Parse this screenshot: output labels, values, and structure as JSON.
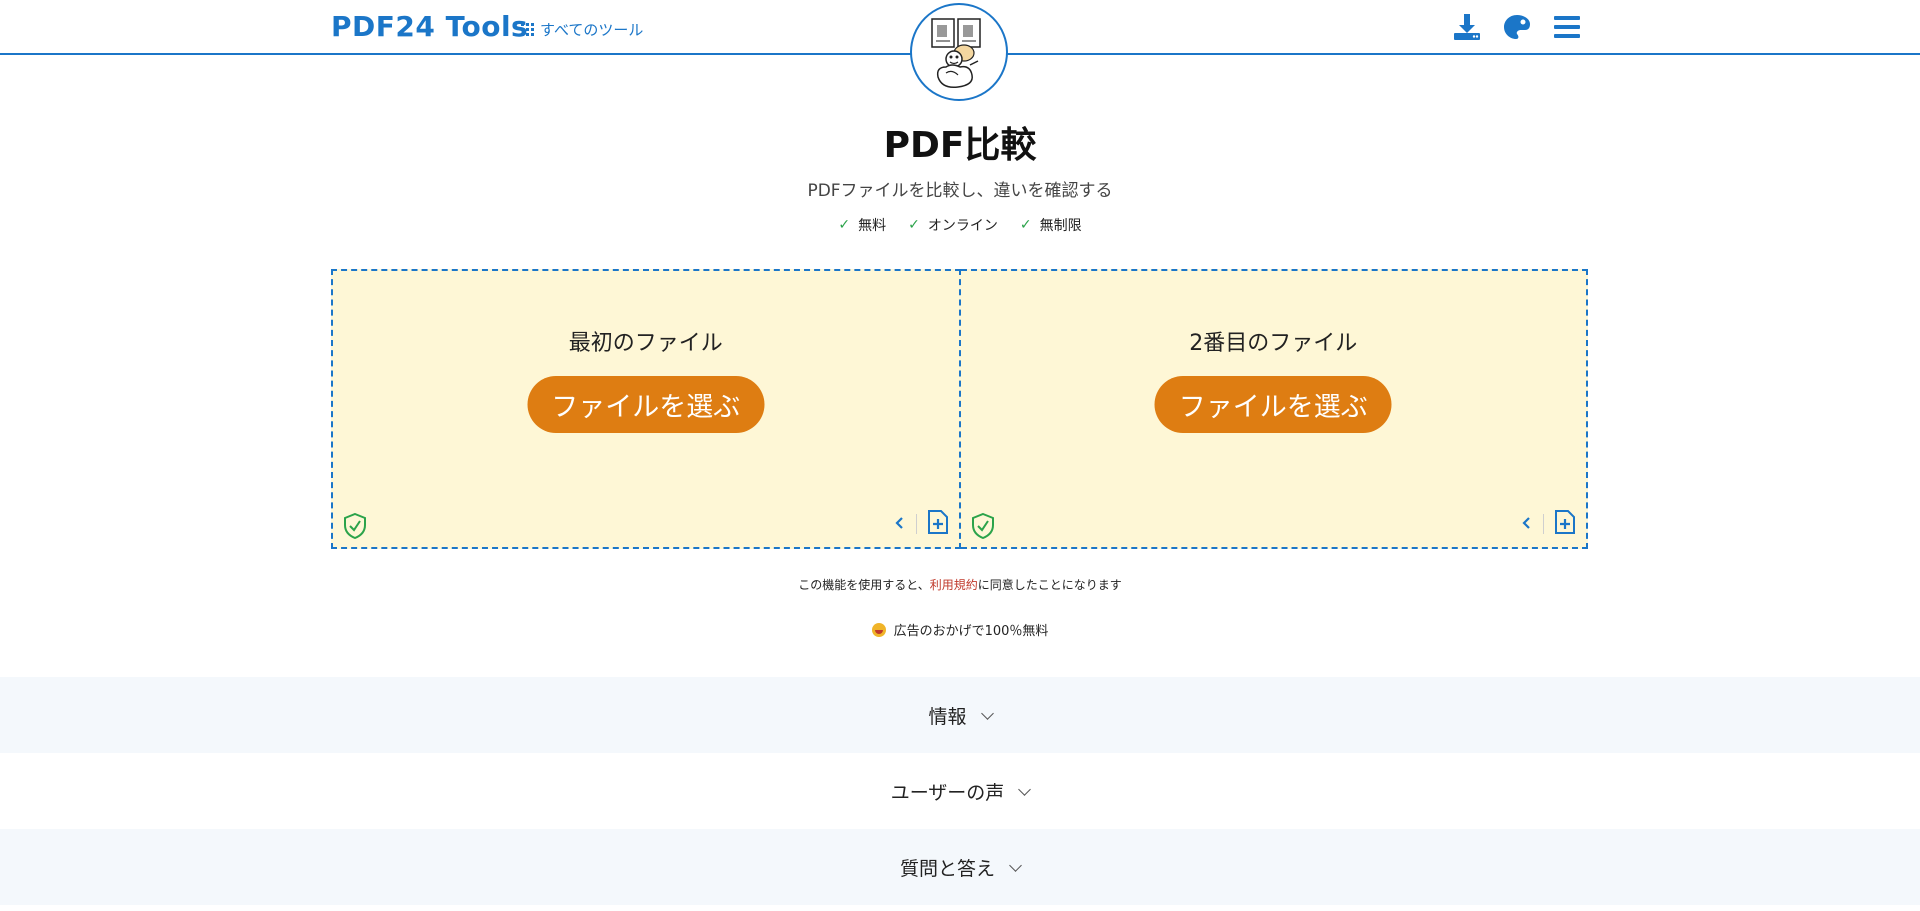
{
  "header": {
    "brand": "PDF24 Tools",
    "all_tools_label": "すべてのツール",
    "icons": [
      "download-icon",
      "palette-icon",
      "menu-icon"
    ]
  },
  "page": {
    "title": "PDF比較",
    "subtitle": "PDFファイルを比較し、違いを確認する",
    "features": [
      "無料",
      "オンライン",
      "無制限"
    ]
  },
  "dropzones": [
    {
      "label": "最初のファイル",
      "button": "ファイルを選ぶ"
    },
    {
      "label": "2番目のファイル",
      "button": "ファイルを選ぶ"
    }
  ],
  "terms": {
    "prefix": "この機能を使用すると、",
    "link": "利用規約",
    "suffix": "に同意したことになります"
  },
  "ads_note": "広告のおかげで100％無料",
  "sections": [
    "情報",
    "ユーザーの声",
    "質問と答え"
  ],
  "colors": {
    "primary": "#1b76c8",
    "button": "#de7d12",
    "dropzone_bg": "#fef7d6",
    "check": "#2ba34a",
    "link": "#c0392b"
  }
}
